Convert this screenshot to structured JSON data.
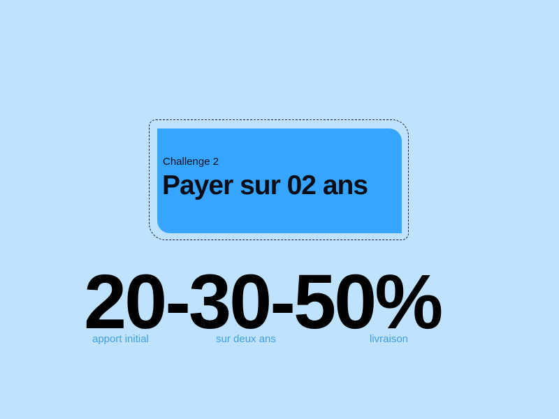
{
  "card": {
    "subtitle": "Challenge 2",
    "title": "Payer sur 02 ans"
  },
  "stat": {
    "value": "20-30-50%",
    "labels": [
      "apport initial",
      "sur deux ans",
      "livraison"
    ]
  },
  "colors": {
    "background": "#bfe3ff",
    "card": "#35a5ff",
    "label": "#3f9ee8",
    "text": "#000000"
  }
}
